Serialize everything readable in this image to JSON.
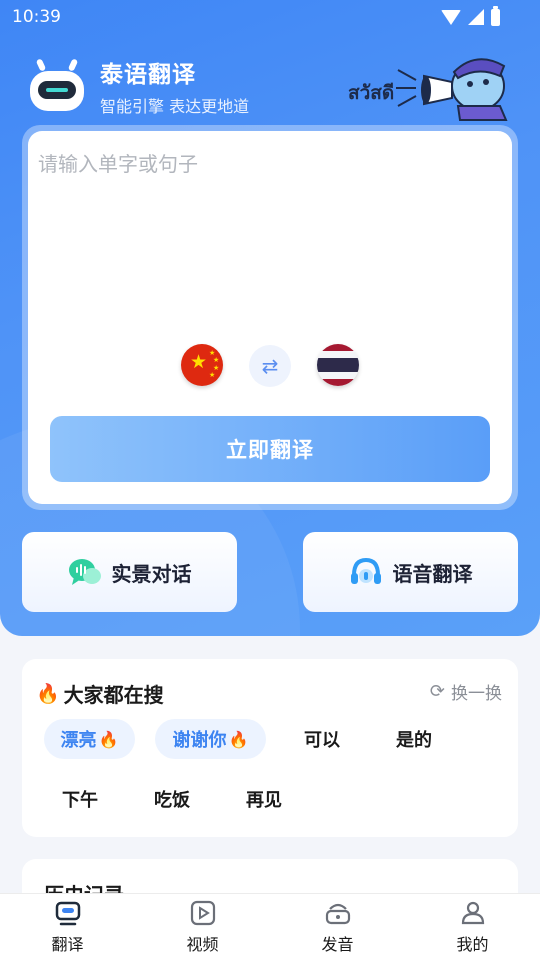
{
  "status": {
    "time": "10:39"
  },
  "app": {
    "title": "泰语翻译",
    "subtitle": "智能引擎 表达更地道",
    "mascot_text": "สวัสดี"
  },
  "translator": {
    "placeholder": "请输入单字或句子",
    "source_language_icon": "china-flag-icon",
    "target_language_icon": "thailand-flag-icon",
    "translate_label": "立即翻译"
  },
  "quick_actions": [
    {
      "label": "实景对话",
      "icon": "chat-bubble-icon"
    },
    {
      "label": "语音翻译",
      "icon": "headset-icon"
    }
  ],
  "hot_search": {
    "title": "大家都在搜",
    "refresh_label": "换一换",
    "tags": [
      {
        "text": "漂亮",
        "hot": true
      },
      {
        "text": "谢谢你",
        "hot": true
      },
      {
        "text": "可以",
        "hot": false
      },
      {
        "text": "是的",
        "hot": false
      },
      {
        "text": "下午",
        "hot": false
      },
      {
        "text": "吃饭",
        "hot": false
      },
      {
        "text": "再见",
        "hot": false
      }
    ]
  },
  "history": {
    "title": "历史记录"
  },
  "tabbar": [
    {
      "label": "翻译",
      "icon": "translate-icon",
      "active": true
    },
    {
      "label": "视频",
      "icon": "video-icon",
      "active": false
    },
    {
      "label": "发音",
      "icon": "pronunciation-icon",
      "active": false
    },
    {
      "label": "我的",
      "icon": "profile-icon",
      "active": false
    }
  ],
  "colors": {
    "primary": "#4f93f7",
    "accent": "#3d84f1",
    "hot_flame": "#ff6b1e"
  }
}
